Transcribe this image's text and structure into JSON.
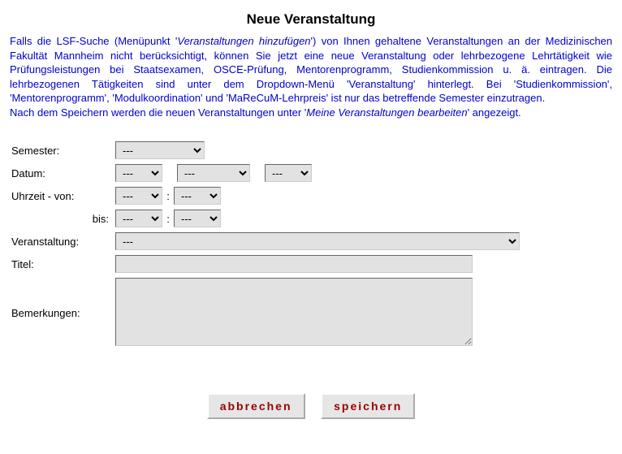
{
  "title": "Neue Veranstaltung",
  "info": {
    "line1a": "Falls die LSF-Suche (Menüpunkt '",
    "line1em": "Veranstaltungen hinzufügen",
    "line1b": "') von Ihnen gehaltene Veranstaltungen an der Medizinischen Fakultät Mannheim nicht berücksichtigt, können Sie jetzt eine neue Veranstaltung oder lehrbezogene Lehrtätigkeit wie Prüfungsleistungen bei Staatsexamen, OSCE-Prüfung, Mentorenprogramm, Studienkommission u. ä. eintragen. Die lehrbezogenen Tätigkeiten sind unter dem Dropdown-Menü 'Veranstaltung' hinterlegt. Bei 'Studienkommission', 'Mentorenprogramm', 'Modulkoordination' und 'MaReCuM-Lehrpreis' ist nur das betreffende Semester einzutragen.",
    "line2a": "Nach dem Speichern werden die neuen Veranstaltungen unter '",
    "line2em": "Meine Veranstaltungen bearbeiten",
    "line2b": "' angezeigt."
  },
  "labels": {
    "semester": "Semester:",
    "date": "Datum:",
    "time_from": "Uhrzeit - von:",
    "time_to": "bis:",
    "event": "Veranstaltung:",
    "title_field": "Titel:",
    "remarks": "Bemerkungen:"
  },
  "values": {
    "semester": "---",
    "day": "---",
    "month": "---",
    "year": "---",
    "from_h": "---",
    "from_m": "---",
    "to_h": "---",
    "to_m": "---",
    "event": "---",
    "title_field": "",
    "remarks": ""
  },
  "buttons": {
    "cancel": "abbrechen",
    "save": "speichern"
  }
}
